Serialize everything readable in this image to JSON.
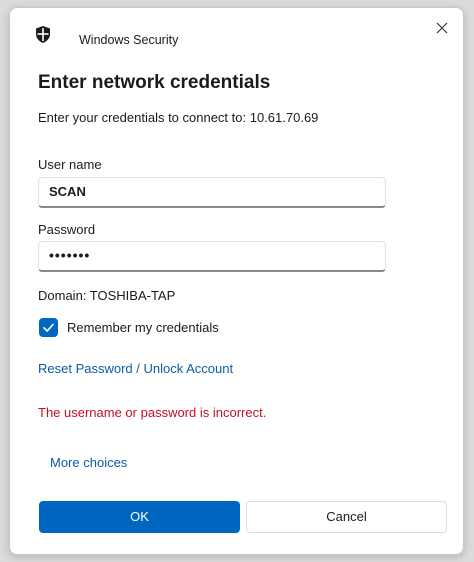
{
  "window": {
    "app_title": "Windows Security",
    "shield_icon": "shield-icon",
    "close_icon": "close-icon"
  },
  "heading": "Enter network credentials",
  "subtitle": "Enter your credentials to connect to: 10.61.70.69",
  "username": {
    "label": "User name",
    "value": "SCAN"
  },
  "password": {
    "label": "Password",
    "masked_value": "•••••••"
  },
  "domain": "Domain: TOSHIBA-TAP",
  "remember": {
    "label": "Remember my credentials",
    "checked": true
  },
  "reset_link": "Reset Password / Unlock Account",
  "error_message": "The username or password is incorrect.",
  "more_choices": "More choices",
  "buttons": {
    "ok": "OK",
    "cancel": "Cancel"
  },
  "colors": {
    "accent": "#0067c0",
    "error": "#c50f1f",
    "link": "#0a5ca8"
  }
}
